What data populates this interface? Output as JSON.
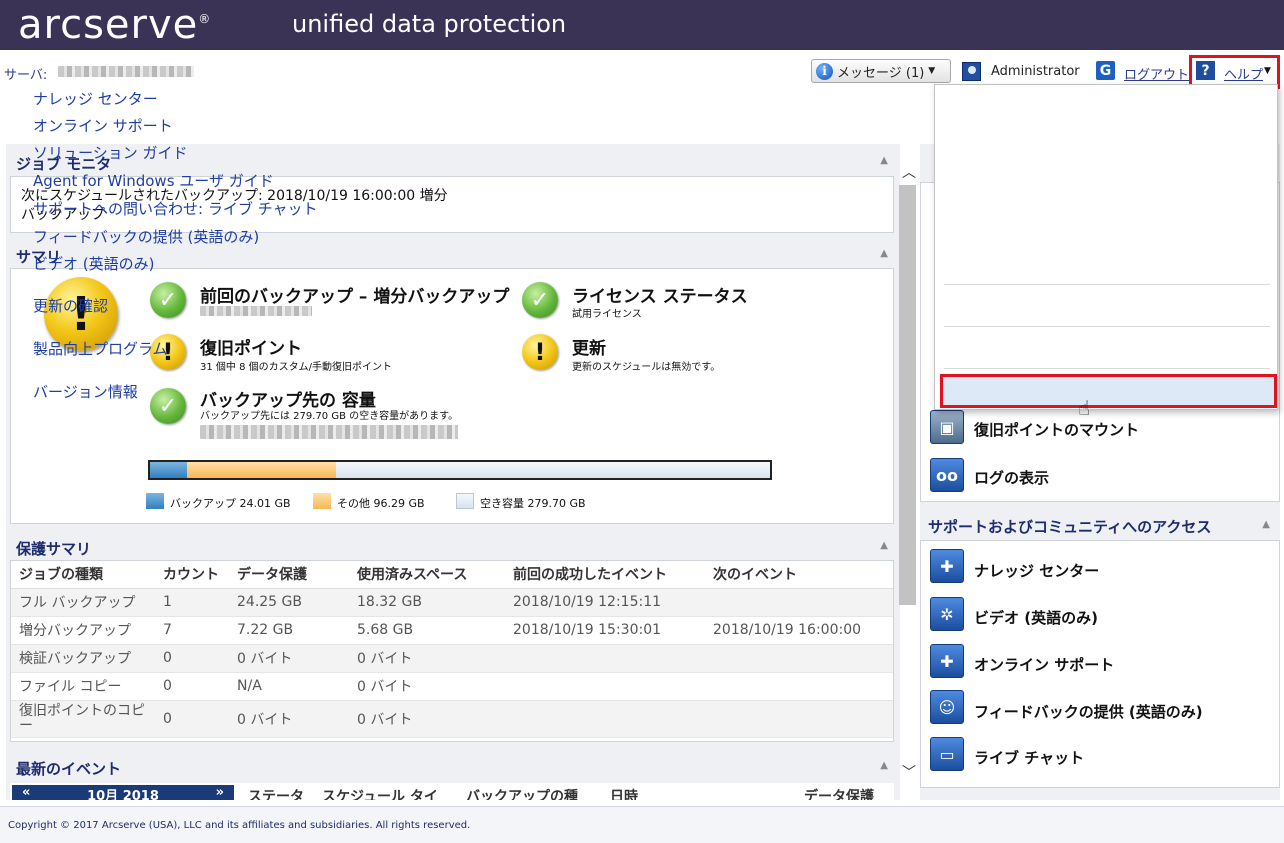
{
  "header": {
    "logo": "arcserve",
    "logo_mark": "®",
    "product": "unified data protection"
  },
  "topbar": {
    "server_label": "サーバ:",
    "messages_label": "メッセージ (1)",
    "admin_label": "Administrator",
    "logout_label": "ログアウト",
    "help_label": "ヘルプ"
  },
  "job_monitor": {
    "title": "ジョブ モニタ",
    "next_schedule_line1": "次にスケジュールされたバックアップ: 2018/10/19 16:00:00 増分",
    "next_schedule_line2": "バックアップ"
  },
  "summary": {
    "title": "サマリ",
    "last_backup_title": "前回のバックアップ – 増分バックアップ",
    "license_title": "ライセンス ステータス",
    "license_sub": "試用ライセンス",
    "recovery_title": "復旧ポイント",
    "recovery_sub": "31 個中 8 個のカスタム/手動復旧ポイント",
    "update_title": "更新",
    "update_sub": "更新のスケジュールは無効です。",
    "capacity_title": "バックアップ先の 容量",
    "capacity_sub": "バックアップ先には 279.70 GB の空き容量があります。",
    "storage": {
      "backup_gb": 24.01,
      "other_gb": 96.29,
      "free_gb": 279.7
    },
    "legend_backup": "バックアップ 24.01 GB",
    "legend_other": "その他 96.29 GB",
    "legend_free": "空き容量 279.70 GB",
    "colors": {
      "backup": "#2f7fbe",
      "other": "#f8b756",
      "free": "#d8e3ef"
    }
  },
  "protection": {
    "title": "保護サマリ",
    "headers": [
      "ジョブの種類",
      "カウント",
      "データ保護",
      "使用済みスペース",
      "前回の成功したイベント",
      "次のイベント"
    ],
    "rows": [
      [
        "フル バックアップ",
        "1",
        "24.25 GB",
        "18.32 GB",
        "2018/10/19 12:15:11",
        ""
      ],
      [
        "増分バックアップ",
        "7",
        "7.22 GB",
        "5.68 GB",
        "2018/10/19 15:30:01",
        "2018/10/19 16:00:00"
      ],
      [
        "検証バックアップ",
        "0",
        "0 バイト",
        "0 バイト",
        "",
        ""
      ],
      [
        "ファイル コピー",
        "0",
        "N/A",
        "0 バイト",
        "",
        ""
      ],
      [
        "復旧ポイントのコピー",
        "0",
        "0 バイト",
        "0 バイト",
        "",
        ""
      ]
    ]
  },
  "events": {
    "title": "最新のイベント",
    "calendar_month": "10月 2018",
    "columns": [
      "ステータ",
      "スケジュール タイ",
      "バックアップの種",
      "日時",
      "データ保護"
    ]
  },
  "right_panel": {
    "mount_label": "復旧ポイントのマウント",
    "logs_label": "ログの表示",
    "support_title": "サポートおよびコミュニティへのアクセス",
    "support_items": [
      "ナレッジ センター",
      "ビデオ (英語のみ)",
      "オンライン サポート",
      "フィードバックの提供 (英語のみ)",
      "ライブ チャット"
    ]
  },
  "help_menu": {
    "items": [
      "ナレッジ センター",
      "オンライン サポート",
      "ソリューション ガイド",
      "Agent for Windows ユーザ ガイド",
      "サポートへの問い合わせ: ライブ チャット",
      "フィードバックの提供 (英語のみ)",
      "ビデオ (英語のみ)"
    ],
    "check_updates": "更新の確認",
    "improvement": "製品向上プログラム",
    "version": "バージョン情報"
  },
  "footer": {
    "copyright": "Copyright © 2017 Arcserve (USA), LLC and its affiliates and subsidiaries. All rights reserved."
  }
}
